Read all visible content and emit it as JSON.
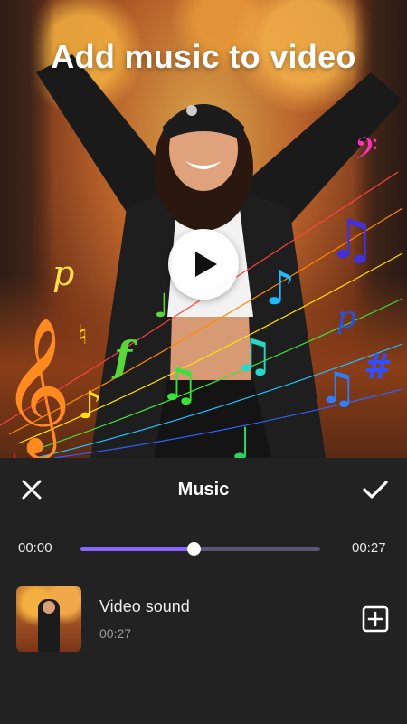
{
  "hero": {
    "title": "Add music to video",
    "play_icon": "play-icon"
  },
  "header": {
    "title": "Music",
    "close_icon": "close-icon",
    "confirm_icon": "checkmark-icon"
  },
  "player": {
    "current_time": "00:00",
    "total_time": "00:27",
    "progress": 0.47
  },
  "tracks": [
    {
      "title": "Video sound",
      "duration": "00:27",
      "action_icon": "add-box-icon"
    }
  ],
  "colors": {
    "background": "#222222",
    "accent": "#8a64ff",
    "track": "#5a5577",
    "text": "#ffffff"
  }
}
